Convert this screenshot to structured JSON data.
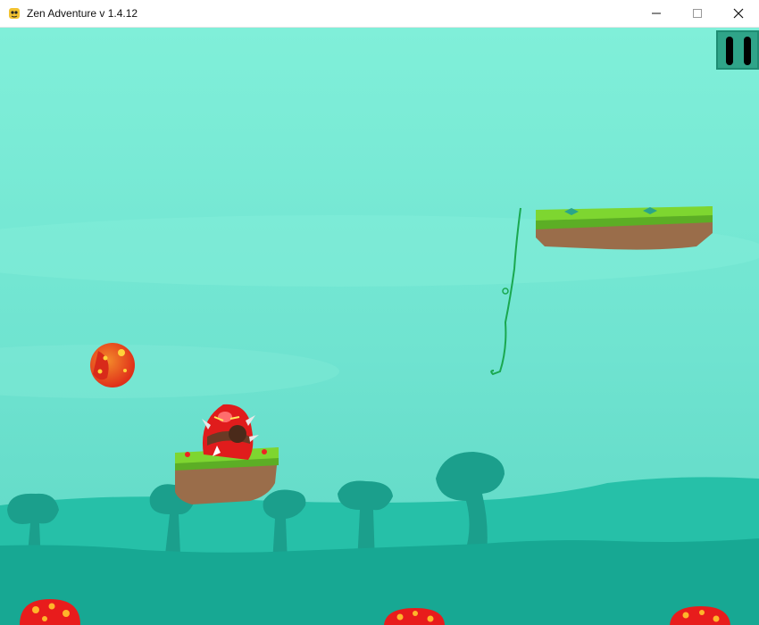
{
  "window": {
    "title": "Zen Adventure v 1.4.12",
    "app_icon": "python-game-icon",
    "controls": {
      "minimize_icon": "minimize-icon",
      "maximize_icon": "maximize-icon",
      "close_icon": "close-icon"
    }
  },
  "game": {
    "pause_icon": "pause-icon",
    "colors": {
      "sky_top": "#7fedd8",
      "sky_bottom": "#5fd8c6",
      "foreground_hill": "#25c0a6",
      "ground": "#1aa894",
      "tree_silhouette": "#1a9e8b",
      "grass": "#7ed630",
      "dirt": "#9a6d4a",
      "enemy_red": "#e01c1c",
      "rope": "#1aa84f"
    }
  }
}
